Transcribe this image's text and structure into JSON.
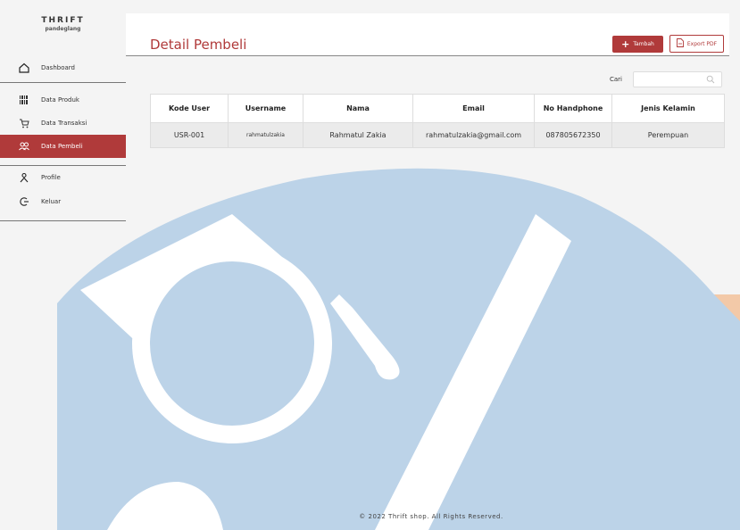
{
  "brand": {
    "title": "THRIFT",
    "subtitle": "pandeglang"
  },
  "sidebar": {
    "items": [
      {
        "label": "Dashboard",
        "icon": "home-icon"
      },
      {
        "label": "Data Produk",
        "icon": "barcode-icon"
      },
      {
        "label": "Data Transaksi",
        "icon": "cart-icon"
      },
      {
        "label": "Data Pembeli",
        "icon": "users-icon",
        "active": true
      },
      {
        "label": "Profile",
        "icon": "user-icon"
      },
      {
        "label": "Keluar",
        "icon": "logout-icon"
      }
    ]
  },
  "header": {
    "title": "Detail Pembeli",
    "add_label": "Tambah",
    "export_label": "Export PDF"
  },
  "search": {
    "label": "Cari",
    "value": ""
  },
  "table": {
    "columns": [
      "Kode User",
      "Username",
      "Nama",
      "Email",
      "No Handphone",
      "Jenis Kelamin"
    ],
    "rows": [
      [
        "USR-001",
        "rahmatulzakia",
        "Rahmatul Zakia",
        "rahmatulzakia@gmail.com",
        "087805672350",
        "Perempuan"
      ]
    ]
  },
  "footer": {
    "text": "© 2022 Thrift shop. All Rights Reserved."
  },
  "colors": {
    "accent": "#b03a3a",
    "watermark": "#bcd3e8",
    "watermark_orange": "#f3c9a8"
  }
}
